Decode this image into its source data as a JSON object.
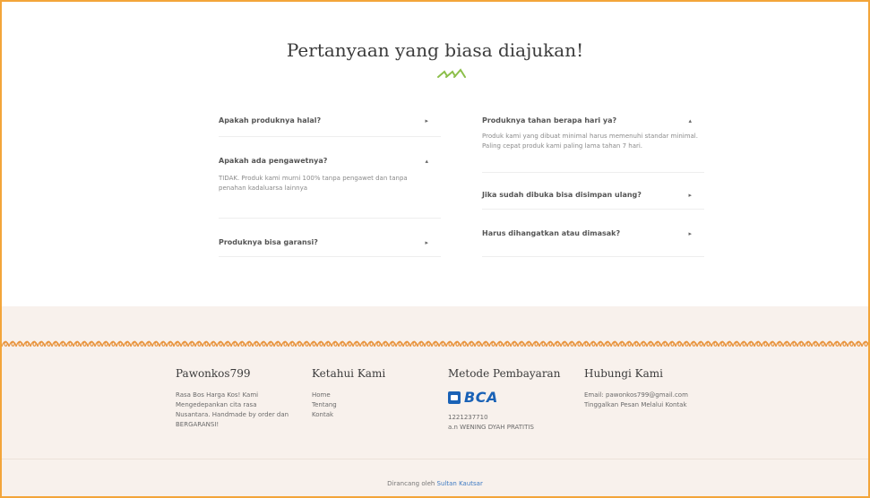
{
  "faq": {
    "title": "Pertanyaan yang biasa diajukan!",
    "left": [
      {
        "question": "Apakah produknya halal?",
        "answer": ""
      },
      {
        "question": "Apakah ada pengawetnya?",
        "answer": "TIDAK. Produk kami murni 100% tanpa pengawet dan tanpa penahan kadaluarsa lainnya"
      },
      {
        "question": "Produknya bisa garansi?",
        "answer": ""
      }
    ],
    "right": [
      {
        "question": "Produknya tahan berapa hari ya?",
        "answer": "Produk kami yang dibuat minimal harus memenuhi standar minimal. Paling cepat produk kami paling lama tahan 7 hari."
      },
      {
        "question": "Jika sudah dibuka bisa disimpan ulang?",
        "answer": ""
      },
      {
        "question": "Harus dihangatkan atau dimasak?",
        "answer": ""
      }
    ]
  },
  "footer": {
    "brand": {
      "title": "Pawonkos799",
      "description": "Rasa Bos Harga Kos! Kami Mengedepankan cita rasa Nusantara. Handmade by order dan BERGARANSI!"
    },
    "about": {
      "title": "Ketahui Kami",
      "links": [
        "Home",
        "Tentang",
        "Kontak"
      ]
    },
    "payment": {
      "title": "Metode Pembayaran",
      "bank_logo": "BCA",
      "account_number": "1221237710",
      "account_name": "a.n WENING DYAH PRATITIS"
    },
    "contact": {
      "title": "Hubungi Kami",
      "email": "Email: pawonkos799@gmail.com",
      "note": "Tinggalkan Pesan Melalui Kontak"
    },
    "credit": {
      "prefix": "Dirancang oleh",
      "author": "Sultan Kautsar"
    }
  },
  "colors": {
    "accent_border": "#f3a53a",
    "footer_bg": "#f8f1ec",
    "wave": "#e8923a",
    "leaf": "#8cbf4a",
    "bca_blue": "#1a62b6",
    "link_blue": "#3f7bc3"
  },
  "icons": {
    "collapsed": "chevron-right-icon",
    "expanded": "chevron-up-icon",
    "title_decoration": "leaf-arrows-icon"
  }
}
